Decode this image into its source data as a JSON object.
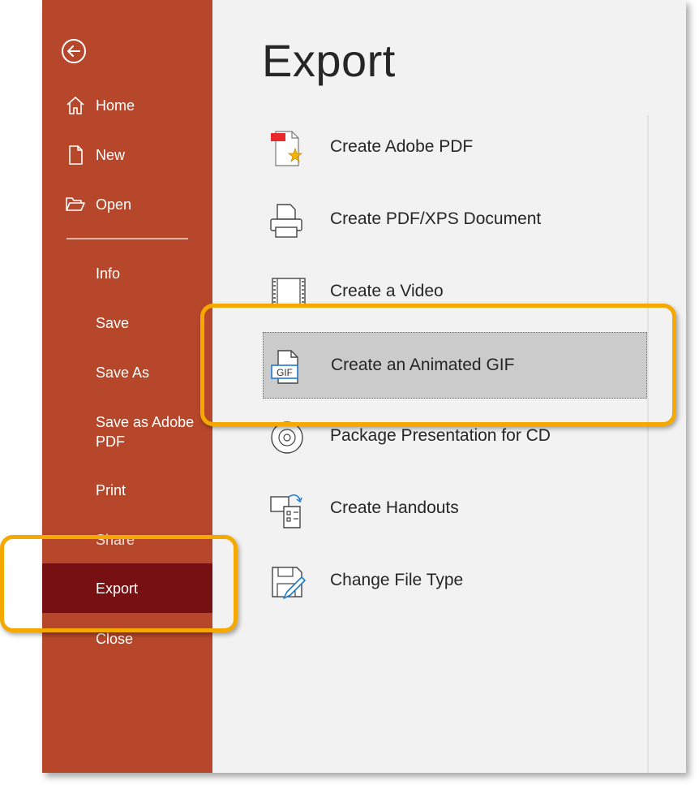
{
  "sidebar": {
    "back_icon": "back-arrow-icon",
    "items": [
      {
        "label": "Home",
        "icon": "home-icon"
      },
      {
        "label": "New",
        "icon": "new-document-icon"
      },
      {
        "label": "Open",
        "icon": "open-folder-icon"
      },
      {
        "label": "Info"
      },
      {
        "label": "Save"
      },
      {
        "label": "Save As"
      },
      {
        "label": "Save as Adobe PDF"
      },
      {
        "label": "Print"
      },
      {
        "label": "Share"
      },
      {
        "label": "Export",
        "active": true
      },
      {
        "label": "Close"
      }
    ]
  },
  "main": {
    "title": "Export",
    "options": [
      {
        "label": "Create Adobe PDF",
        "icon": "adobe-pdf-icon"
      },
      {
        "label": "Create PDF/XPS Document",
        "icon": "printer-document-icon"
      },
      {
        "label": "Create a Video",
        "icon": "video-film-icon"
      },
      {
        "label": "Create an Animated GIF",
        "icon": "gif-file-icon",
        "icon_text": "GIF",
        "selected": true
      },
      {
        "label": "Package Presentation for CD",
        "icon": "cd-disc-icon"
      },
      {
        "label": "Create Handouts",
        "icon": "handouts-icon"
      },
      {
        "label": "Change File Type",
        "icon": "change-file-type-icon"
      }
    ]
  },
  "colors": {
    "sidebar_bg": "#b7472a",
    "active_item_bg": "#771012",
    "main_bg": "#f2f2f2",
    "selected_option_bg": "#cbcbcb",
    "highlight_border": "#f5a800"
  }
}
